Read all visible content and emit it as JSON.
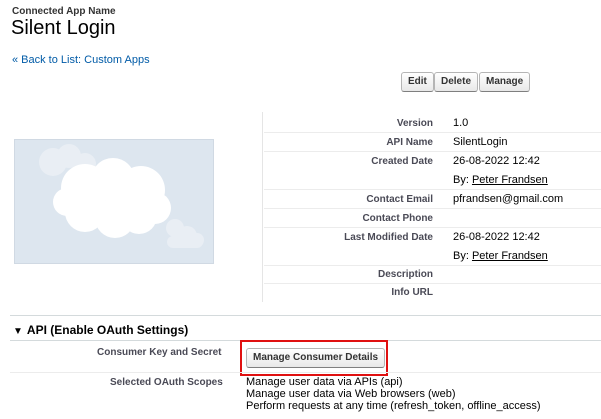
{
  "header": {
    "subtitle": "Connected App Name",
    "title": "Silent Login",
    "back_link": "« Back to List: Custom Apps"
  },
  "toolbar": {
    "edit_label": "Edit",
    "delete_label": "Delete",
    "manage_label": "Manage"
  },
  "details": {
    "version_label": "Version",
    "version_value": "1.0",
    "api_name_label": "API Name",
    "api_name_value": "SilentLogin",
    "created_date_label": "Created Date",
    "created_date_value": "26-08-2022 12:42",
    "created_by_prefix": "By:",
    "created_by_name": "Peter Frandsen",
    "contact_email_label": "Contact Email",
    "contact_email_value": "pfrandsen@gmail.com",
    "contact_phone_label": "Contact Phone",
    "last_modified_label": "Last Modified Date",
    "last_modified_value": "26-08-2022 12:42",
    "modified_by_prefix": "By:",
    "modified_by_name": "Peter Frandsen",
    "description_label": "Description",
    "info_url_label": "Info URL"
  },
  "api_section": {
    "title": "API (Enable OAuth Settings)",
    "consumer_label": "Consumer Key and Secret",
    "manage_consumer_label": "Manage Consumer Details",
    "scopes_label": "Selected OAuth Scopes",
    "scopes": [
      "Manage user data via APIs (api)",
      "Manage user data via Web browsers (web)",
      "Perform requests at any time (refresh_token, offline_access)"
    ]
  },
  "colors": {
    "link": "#015ba7",
    "highlight": "#e01010",
    "logo_bg": "#dde6ef"
  }
}
